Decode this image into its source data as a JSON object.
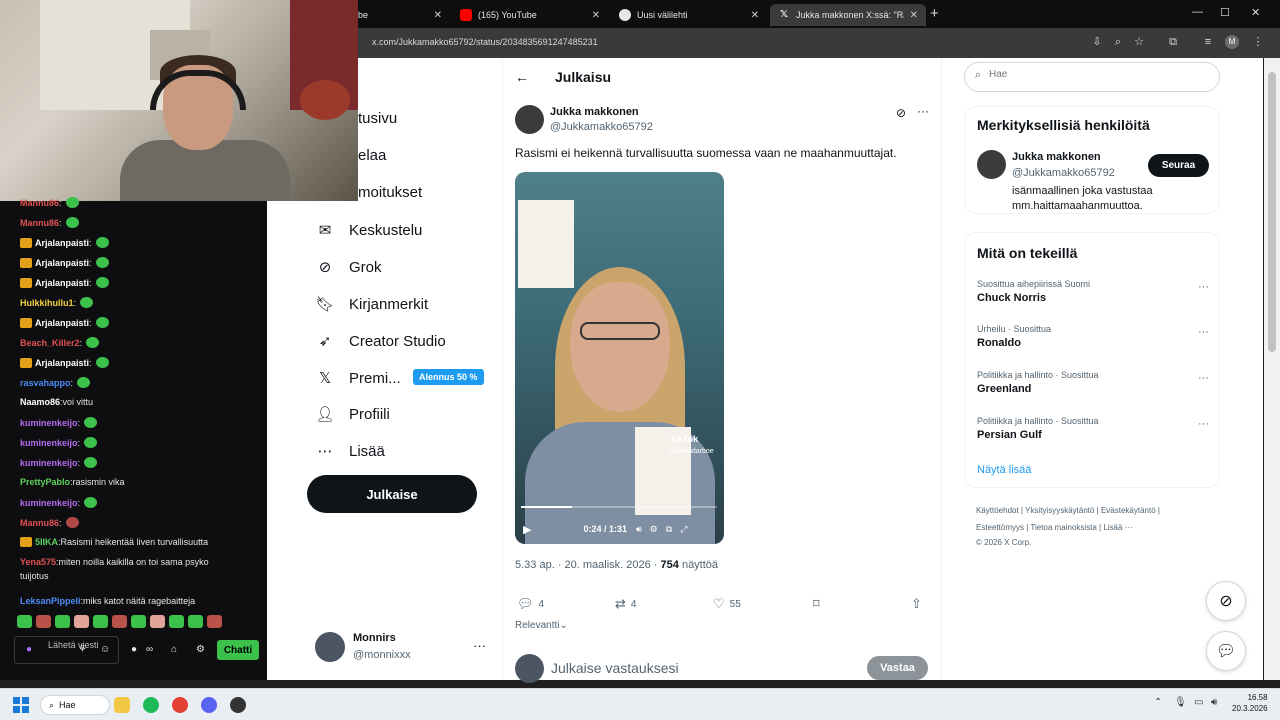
{
  "browser": {
    "tabs": [
      {
        "title": "be"
      },
      {
        "title": "(165) YouTube"
      },
      {
        "title": "Uusi välilehti"
      },
      {
        "title": "Jukka makkonen X:ssä: \"Rasism"
      }
    ],
    "url": "x.com/Jukkamakko65792/status/2034835691247485231",
    "new_tab_icon": "plus-icon",
    "window_controls": [
      "minimize",
      "maximize",
      "close"
    ]
  },
  "nav": {
    "items": [
      {
        "label": "tusivu",
        "icon": "home-icon"
      },
      {
        "label": "elaa",
        "icon": "explore-icon"
      },
      {
        "label": "moitukset",
        "icon": "bell-icon"
      },
      {
        "label": "Keskustelu",
        "icon": "mail-icon"
      },
      {
        "label": "Grok",
        "icon": "grok-icon"
      },
      {
        "label": "Kirjanmerkit",
        "icon": "bookmark-icon"
      },
      {
        "label": "Creator Studio",
        "icon": "rocket-icon"
      },
      {
        "label": "Premi...",
        "icon": "x-logo-icon"
      },
      {
        "label": "Profiili",
        "icon": "person-icon"
      },
      {
        "label": "Lisää",
        "icon": "more-circle-icon"
      }
    ],
    "premium_badge": "Alennus 50 %",
    "publish_label": "Julkaise",
    "me": {
      "name": "Monnirs",
      "handle": "@monnixxx",
      "more": "···"
    }
  },
  "post": {
    "back_icon": "←",
    "page_title": "Julkaisu",
    "author_name": "Jukka makkonen",
    "author_handle": "@Jukkamakko65792",
    "text": "Rasismi ei heikennä turvallisuutta suomessa vaan ne maahanmuuttajat.",
    "video": {
      "time": "0:24 / 1:31",
      "progress": 0.26,
      "watermark": "TikTok",
      "watermark_handle": "@patvidarboe"
    },
    "meta_time": "5.33 ap. · 20. maalisk. 2026 · ",
    "views": "754",
    "views_label": " näyttöä",
    "actions": {
      "replies": "4",
      "reposts": "4",
      "likes": "55"
    },
    "sort_label": "Relevantti",
    "reply_placeholder": "Julkaise vastauksesi",
    "reply_button": "Vastaa"
  },
  "right": {
    "search_placeholder": "Hae",
    "relevant_title": "Merkityksellisiä henkilöitä",
    "relevant_person": {
      "name": "Jukka makkonen",
      "handle": "@Jukkamakko65792",
      "bio": "isänmaallinen joka vastustaa mm.haittamaahanmuuttoa.",
      "follow": "Seuraa"
    },
    "trends_title": "Mitä on tekeillä",
    "trends": [
      {
        "context": "Suosittua aihepiirissä Suomi",
        "title": "Chuck Norris"
      },
      {
        "context": "Urheilu · Suosittua",
        "title": "Ronaldo"
      },
      {
        "context": "Politiikka ja hallinto · Suosittua",
        "title": "Greenland"
      },
      {
        "context": "Politiikka ja hallinto · Suosittua",
        "title": "Persian Gulf"
      }
    ],
    "show_more": "Näytä lisää",
    "footer_line1": "Käyttöehdot  |  Yksityisyyskäytäntö  |  Evästekäytäntö  |",
    "footer_line2": "Esteettömyys  |  Tietoa mainoksista  |  Lisää ···",
    "footer_line3": "© 2026 X Corp."
  },
  "chat": {
    "messages": [
      {
        "user": "Mannu86",
        "text": "",
        "color": "#e05252",
        "badge": false,
        "emote": "green"
      },
      {
        "user": "Mannu86",
        "text": "",
        "color": "#e05252",
        "badge": false,
        "emote": "green"
      },
      {
        "user": "Arjalanpaisti",
        "text": "",
        "color": "#ffffff",
        "badge": true,
        "emote": "green"
      },
      {
        "user": "Arjalanpaisti",
        "text": "",
        "color": "#ffffff",
        "badge": true,
        "emote": "green"
      },
      {
        "user": "Arjalanpaisti",
        "text": "",
        "color": "#ffffff",
        "badge": true,
        "emote": "green"
      },
      {
        "user": "Hulkkihullu1",
        "text": "",
        "color": "#f5d142",
        "badge": false,
        "emote": "green"
      },
      {
        "user": "Arjalanpaisti",
        "text": "",
        "color": "#ffffff",
        "badge": true,
        "emote": "green"
      },
      {
        "user": "Beach_Killer2",
        "text": "",
        "color": "#e05252",
        "badge": false,
        "emote": "green"
      },
      {
        "user": "Arjalanpaisti",
        "text": "",
        "color": "#ffffff",
        "badge": true,
        "emote": "green"
      },
      {
        "user": "rasvahappo",
        "text": "",
        "color": "#4b8bf5",
        "badge": false,
        "emote": "green"
      },
      {
        "user": "Naamo86",
        "text": "voi vittu",
        "color": "#ffffff",
        "badge": false,
        "emote": ""
      },
      {
        "user": "kuminenkeijo",
        "text": "",
        "color": "#b46cf0",
        "badge": false,
        "emote": "green"
      },
      {
        "user": "kuminenkeijo",
        "text": "",
        "color": "#b46cf0",
        "badge": false,
        "emote": "green"
      },
      {
        "user": "kuminenkeijo",
        "text": "",
        "color": "#b46cf0",
        "badge": false,
        "emote": "green"
      },
      {
        "user": "PrettyPablo",
        "text": "rasismin vika",
        "color": "#5fd35f",
        "badge": false,
        "emote": ""
      },
      {
        "user": "kuminenkeijo",
        "text": "",
        "color": "#b46cf0",
        "badge": false,
        "emote": "green"
      },
      {
        "user": "Mannu86",
        "text": "",
        "color": "#e05252",
        "badge": false,
        "emote": "red"
      },
      {
        "user": "5IIKA",
        "text": "Rasismi heikentää liven turvallisuutta",
        "color": "#5fd35f",
        "badge": true,
        "emote": ""
      },
      {
        "user": "Yena575",
        "text": "miten noilla kaikilla on toi sama psyko",
        "color": "#e05252",
        "badge": false,
        "emote": ""
      },
      {
        "user": "",
        "text": "tuijotus",
        "color": "#ffffff",
        "badge": false,
        "emote": ""
      },
      {
        "user": "LeksanPippeli",
        "text": "miks katot näitä ragebaitteja",
        "color": "#4b8bf5",
        "badge": false,
        "emote": ""
      }
    ],
    "input_placeholder": "Lähetä viesti",
    "send_button": "Chatti"
  },
  "taskbar": {
    "search_label": "Hae",
    "time": "16.58",
    "date": "20.3.2026"
  }
}
